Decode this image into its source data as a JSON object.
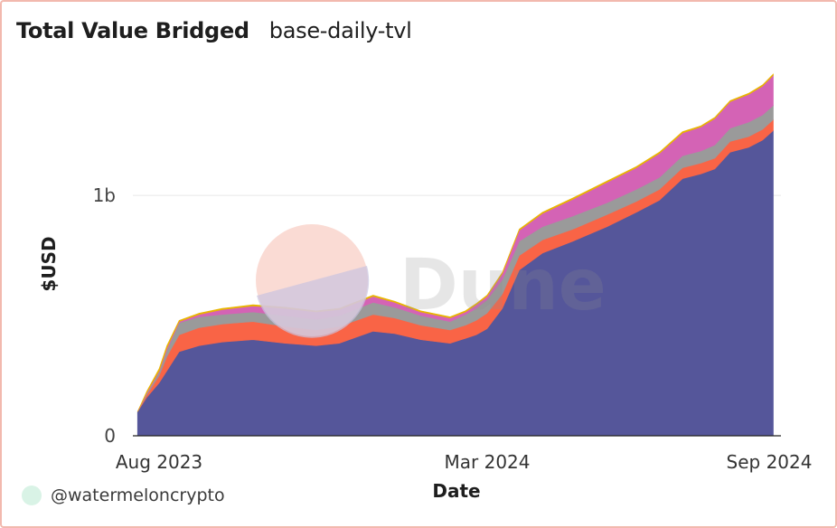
{
  "header": {
    "title": "Total Value Bridged",
    "subtitle": "base-daily-tvl"
  },
  "footer": {
    "credit": "@watermeloncrypto"
  },
  "watermark": "Dune",
  "chart_data": {
    "type": "area",
    "stacked": true,
    "title": "Total Value Bridged",
    "subtitle": "base-daily-tvl",
    "xlabel": "Date",
    "ylabel": "$USD",
    "x_ticks": [
      "Aug 2023",
      "Mar 2024",
      "Sep 2024"
    ],
    "y_ticks": [
      {
        "value": 0,
        "label": "0"
      },
      {
        "value": 1000000000,
        "label": "1b"
      }
    ],
    "ylim": [
      0,
      1580000000
    ],
    "xlim": [
      "2023-07-26",
      "2024-09-22"
    ],
    "legend": "none",
    "grid": "horizontal",
    "x": [
      "2023-08-01",
      "2023-08-07",
      "2023-08-15",
      "2023-08-20",
      "2023-08-28",
      "2023-09-10",
      "2023-09-25",
      "2023-10-15",
      "2023-11-05",
      "2023-11-25",
      "2023-12-10",
      "2024-01-01",
      "2024-01-15",
      "2024-02-01",
      "2024-02-20",
      "2024-03-01",
      "2024-03-08",
      "2024-03-15",
      "2024-03-25",
      "2024-04-05",
      "2024-04-20",
      "2024-05-10",
      "2024-06-01",
      "2024-06-20",
      "2024-07-05",
      "2024-07-20",
      "2024-08-01",
      "2024-08-10",
      "2024-08-20",
      "2024-09-01",
      "2024-09-10",
      "2024-09-17"
    ],
    "series": [
      {
        "color": "#55569a",
        "values": [
          100,
          160,
          220,
          270,
          350,
          375,
          390,
          400,
          385,
          375,
          385,
          435,
          425,
          400,
          385,
          405,
          420,
          445,
          530,
          690,
          760,
          810,
          870,
          930,
          980,
          1070,
          1090,
          1110,
          1180,
          1200,
          1230,
          1270
        ]
      },
      {
        "color": "#f96446",
        "values": [
          0,
          10,
          30,
          60,
          70,
          75,
          75,
          75,
          70,
          65,
          70,
          70,
          65,
          60,
          55,
          55,
          60,
          65,
          60,
          60,
          55,
          50,
          50,
          45,
          45,
          45,
          45,
          45,
          45,
          45,
          45,
          45
        ]
      },
      {
        "color": "#9a9a9a",
        "values": [
          0,
          5,
          15,
          25,
          50,
          45,
          40,
          40,
          45,
          45,
          45,
          50,
          45,
          40,
          35,
          45,
          50,
          55,
          60,
          60,
          55,
          55,
          50,
          50,
          50,
          50,
          50,
          55,
          55,
          60,
          60,
          60
        ]
      },
      {
        "color": "#d463b5",
        "values": [
          0,
          5,
          5,
          10,
          5,
          10,
          20,
          25,
          30,
          30,
          25,
          25,
          20,
          15,
          15,
          10,
          15,
          15,
          25,
          45,
          55,
          70,
          85,
          90,
          100,
          95,
          100,
          110,
          110,
          115,
          120,
          125
        ]
      },
      {
        "color": "#e8b500",
        "values": [
          0,
          5,
          10,
          10,
          5,
          5,
          5,
          5,
          5,
          5,
          5,
          5,
          5,
          5,
          5,
          5,
          5,
          5,
          5,
          5,
          5,
          5,
          5,
          5,
          5,
          5,
          5,
          5,
          5,
          5,
          5,
          5
        ]
      }
    ],
    "value_unit": "million USD"
  }
}
